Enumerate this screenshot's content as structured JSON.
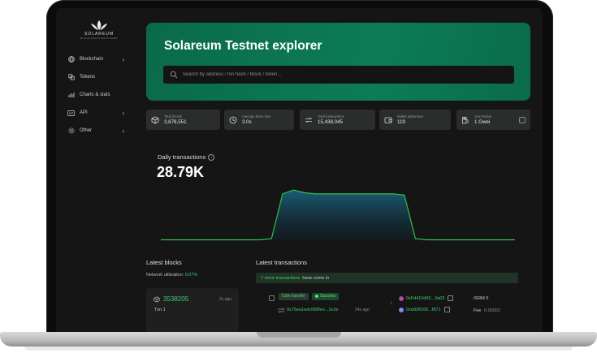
{
  "brand": {
    "name": "SOLAREUM",
    "tagline": "BLOCKCHAIN EXPLORER"
  },
  "sidebar": {
    "items": [
      {
        "label": "Blockchain",
        "icon": "globe-icon",
        "has_submenu": true
      },
      {
        "label": "Tokens",
        "icon": "tokens-icon",
        "has_submenu": false
      },
      {
        "label": "Charts & stats",
        "icon": "chart-icon",
        "has_submenu": false
      },
      {
        "label": "API",
        "icon": "api-icon",
        "has_submenu": true
      },
      {
        "label": "Other",
        "icon": "gear-icon",
        "has_submenu": true
      }
    ]
  },
  "hero": {
    "title": "Solareum Testnet explorer",
    "search_placeholder": "Search by address / txn hash / block / token..."
  },
  "stats": [
    {
      "label": "Total blocks",
      "value": "3,878,551",
      "icon": "cube-icon"
    },
    {
      "label": "Average block time",
      "value": "3.0s",
      "icon": "clock-icon"
    },
    {
      "label": "Total transactions",
      "value": "15,438,045",
      "icon": "transfer-icon"
    },
    {
      "label": "Wallet addresses",
      "value": "119",
      "icon": "wallet-icon"
    },
    {
      "label": "Gas tracker",
      "value": "1 Gwei",
      "icon": "gas-icon"
    }
  ],
  "daily": {
    "title": "Daily transactions",
    "value": "28.79K"
  },
  "chart_data": {
    "type": "area",
    "title": "Daily transactions",
    "series": [
      {
        "values": [
          0.08,
          0.08,
          0.08,
          0.08,
          0.08,
          0.08,
          0.08,
          0.08,
          0.08,
          0.08,
          0.1,
          0.9,
          0.97,
          0.92,
          0.9,
          0.9,
          0.9,
          0.9,
          0.9,
          0.9,
          0.9,
          0.9,
          0.88,
          0.1,
          0.08,
          0.08,
          0.08,
          0.08,
          0.08,
          0.08,
          0.08,
          0.08,
          0.08
        ]
      }
    ],
    "grid": false
  },
  "latest_blocks": {
    "title": "Latest blocks",
    "net_label": "Network utilization:",
    "net_value": "0.07%",
    "block": {
      "number": "3538205",
      "ago": "2s ago",
      "txn": "Txn 1"
    }
  },
  "latest_tx": {
    "title": "Latest transactions",
    "banner_count": "7 more transactions",
    "banner_rest": "have come in",
    "row": {
      "type": "Coin transfer",
      "status": "Success",
      "hash": "0x75ea1edc068fee...1e2e",
      "ago": "24s ago",
      "from": "0xFd410d92...3a03",
      "to": "0xdd38105...f871",
      "amount": "tSRM 0",
      "fee_label": "Fee",
      "fee_value": "0.00002"
    }
  },
  "colors": {
    "accent": "#3ecf6e",
    "hero": "#0c7d56",
    "bg": "#151515"
  }
}
